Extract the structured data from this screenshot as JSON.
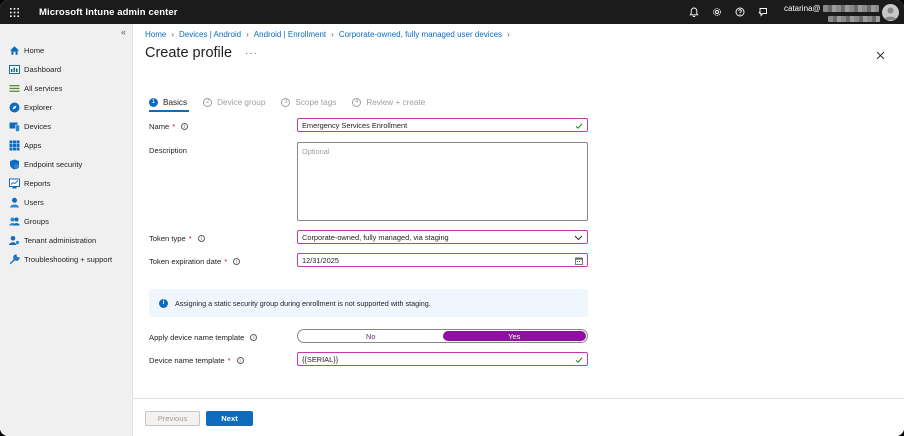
{
  "header": {
    "app_title": "Microsoft Intune admin center",
    "account_name": "catarina@"
  },
  "sidebar": {
    "collapse_glyph": "«",
    "items": [
      {
        "label": "Home",
        "icon": "home-icon"
      },
      {
        "label": "Dashboard",
        "icon": "dashboard-icon"
      },
      {
        "label": "All services",
        "icon": "list-icon"
      },
      {
        "label": "Explorer",
        "icon": "explorer-icon"
      },
      {
        "label": "Devices",
        "icon": "devices-icon"
      },
      {
        "label": "Apps",
        "icon": "apps-icon"
      },
      {
        "label": "Endpoint security",
        "icon": "shield-icon"
      },
      {
        "label": "Reports",
        "icon": "reports-icon"
      },
      {
        "label": "Users",
        "icon": "user-icon"
      },
      {
        "label": "Groups",
        "icon": "groups-icon"
      },
      {
        "label": "Tenant administration",
        "icon": "tenant-admin-icon"
      },
      {
        "label": "Troubleshooting + support",
        "icon": "wrench-icon"
      }
    ]
  },
  "breadcrumb": [
    "Home",
    "Devices | Android",
    "Android | Enrollment",
    "Corporate-owned, fully managed user devices"
  ],
  "page": {
    "title": "Create profile",
    "more": "···"
  },
  "steps": [
    {
      "num": "1",
      "label": "Basics",
      "active": true
    },
    {
      "num": "2",
      "label": "Device group",
      "active": false
    },
    {
      "num": "3",
      "label": "Scope tags",
      "active": false
    },
    {
      "num": "4",
      "label": "Review + create",
      "active": false
    }
  ],
  "form": {
    "name_label": "Name",
    "name_value": "Emergency Services Enrollment",
    "description_label": "Description",
    "description_placeholder": "Optional",
    "token_type_label": "Token type",
    "token_type_value": "Corporate-owned, fully managed, via staging",
    "token_exp_label": "Token expiration date",
    "token_exp_value": "12/31/2025",
    "info_message": "Assigning a static security group during enrollment is not supported with staging.",
    "apply_template_label": "Apply device name template",
    "toggle_no": "No",
    "toggle_yes": "Yes",
    "toggle_selected": "Yes",
    "template_label": "Device name template",
    "template_value": "{{SERIAL}}",
    "required_mark": "*"
  },
  "footer": {
    "previous_label": "Previous",
    "next_label": "Next"
  },
  "colors": {
    "accent": "#0f6cbd",
    "focus_border": "#c239b3",
    "toggle_on": "#8f0fa0",
    "valid_check": "#107c10"
  }
}
